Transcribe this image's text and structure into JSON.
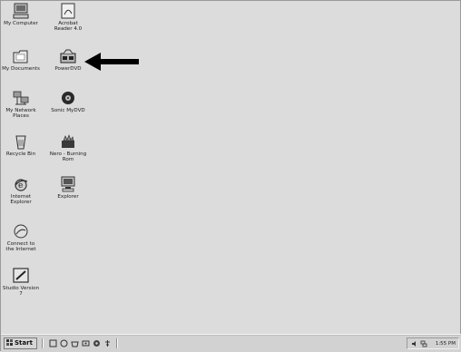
{
  "desktop": {
    "icons": [
      {
        "label": "My Computer",
        "icon": "my-computer-icon"
      },
      {
        "label": "Acrobat\nReader 4.0",
        "icon": "acrobat-reader-icon"
      },
      {
        "label": "My Documents",
        "icon": "my-documents-icon"
      },
      {
        "label": "PowerDVD",
        "icon": "powerdvd-icon"
      },
      {
        "label": "My Network\nPlaces",
        "icon": "network-places-icon"
      },
      {
        "label": "Sonic MyDVD",
        "icon": "sonic-mydvd-icon"
      },
      {
        "label": "Recycle Bin",
        "icon": "recycle-bin-icon"
      },
      {
        "label": "Nero - Burning\nRom",
        "icon": "nero-burning-rom-icon"
      },
      {
        "label": "Internet\nExplorer",
        "icon": "internet-explorer-icon"
      },
      {
        "label": "Explorer",
        "icon": "explorer-icon"
      },
      {
        "label": "Connect to\nthe Internet",
        "icon": "connect-internet-icon"
      },
      {
        "label": "Studio Version\n7",
        "icon": "studio-version-icon"
      }
    ]
  },
  "taskbar": {
    "start_label": "Start",
    "quick_launch": [
      "quick-launch-1-icon",
      "quick-launch-2-icon",
      "quick-launch-3-icon",
      "quick-launch-4-icon",
      "quick-launch-5-icon",
      "quick-launch-6-icon"
    ],
    "clock": "1:55 PM"
  }
}
